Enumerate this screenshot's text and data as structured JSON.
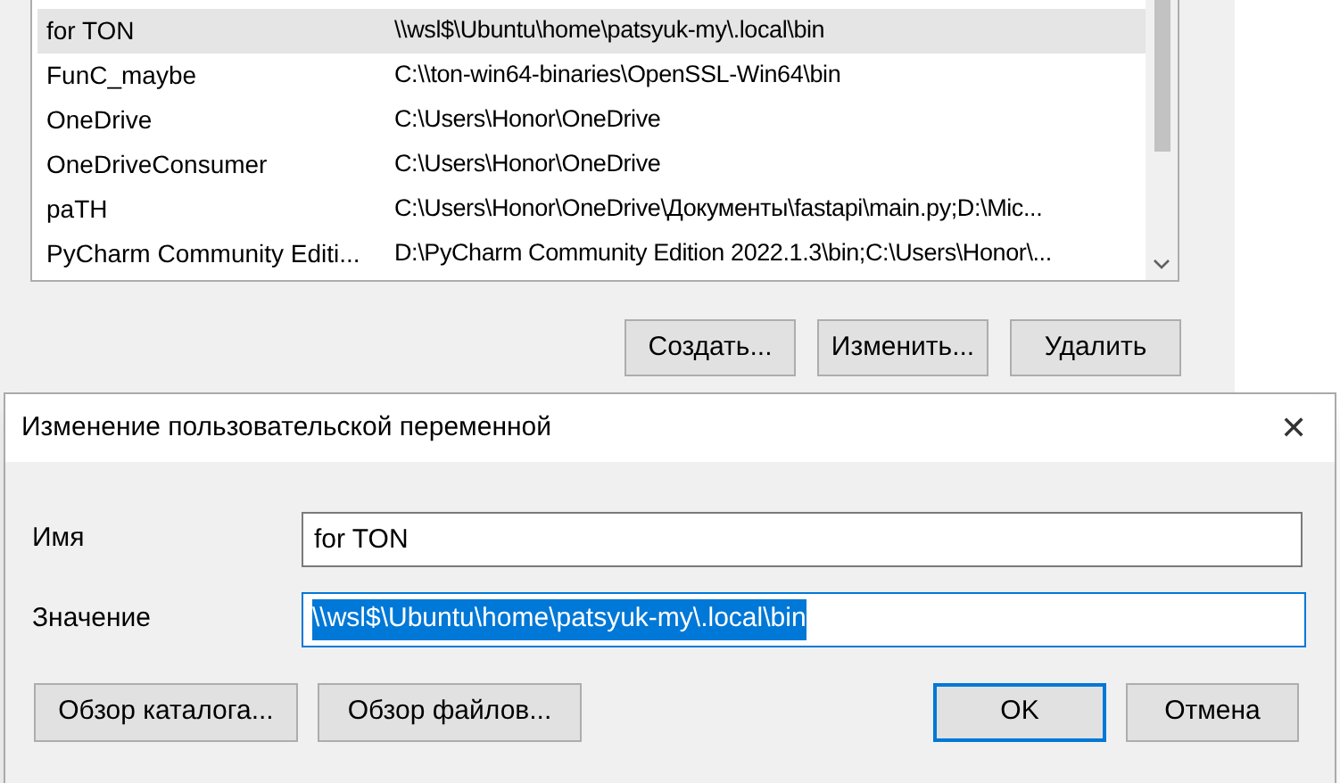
{
  "variables_list": {
    "rows": [
      {
        "name": "for TON",
        "value": "\\\\wsl$\\Ubuntu\\home\\patsyuk-my\\.local\\bin",
        "selected": true
      },
      {
        "name": "FunC_maybe",
        "value": "C:\\\\ton-win64-binaries\\OpenSSL-Win64\\bin",
        "selected": false
      },
      {
        "name": "OneDrive",
        "value": "C:\\Users\\Honor\\OneDrive",
        "selected": false
      },
      {
        "name": "OneDriveConsumer",
        "value": "C:\\Users\\Honor\\OneDrive",
        "selected": false
      },
      {
        "name": "paTH",
        "value": "C:\\Users\\Honor\\OneDrive\\Документы\\fastapi\\main.py;D:\\Mic...",
        "selected": false
      },
      {
        "name": "PyCharm Community Editi...",
        "value": "D:\\PyCharm Community Edition 2022.1.3\\bin;C:\\Users\\Honor\\...",
        "selected": false
      }
    ]
  },
  "list_buttons": [
    "Создать...",
    "Изменить...",
    "Удалить"
  ],
  "dialog": {
    "title": "Изменение пользовательской переменной",
    "close": "✕",
    "name_label": "Имя",
    "name_value": "for TON",
    "value_label": "Значение",
    "value_value": "\\\\wsl$\\Ubuntu\\home\\patsyuk-my\\.local\\bin",
    "value_selected": true,
    "browse_buttons": [
      "Обзор каталога...",
      "Обзор файлов..."
    ],
    "buttons": [
      {
        "label": "OK",
        "default": true
      },
      {
        "label": "Отмена",
        "default": false
      }
    ]
  }
}
